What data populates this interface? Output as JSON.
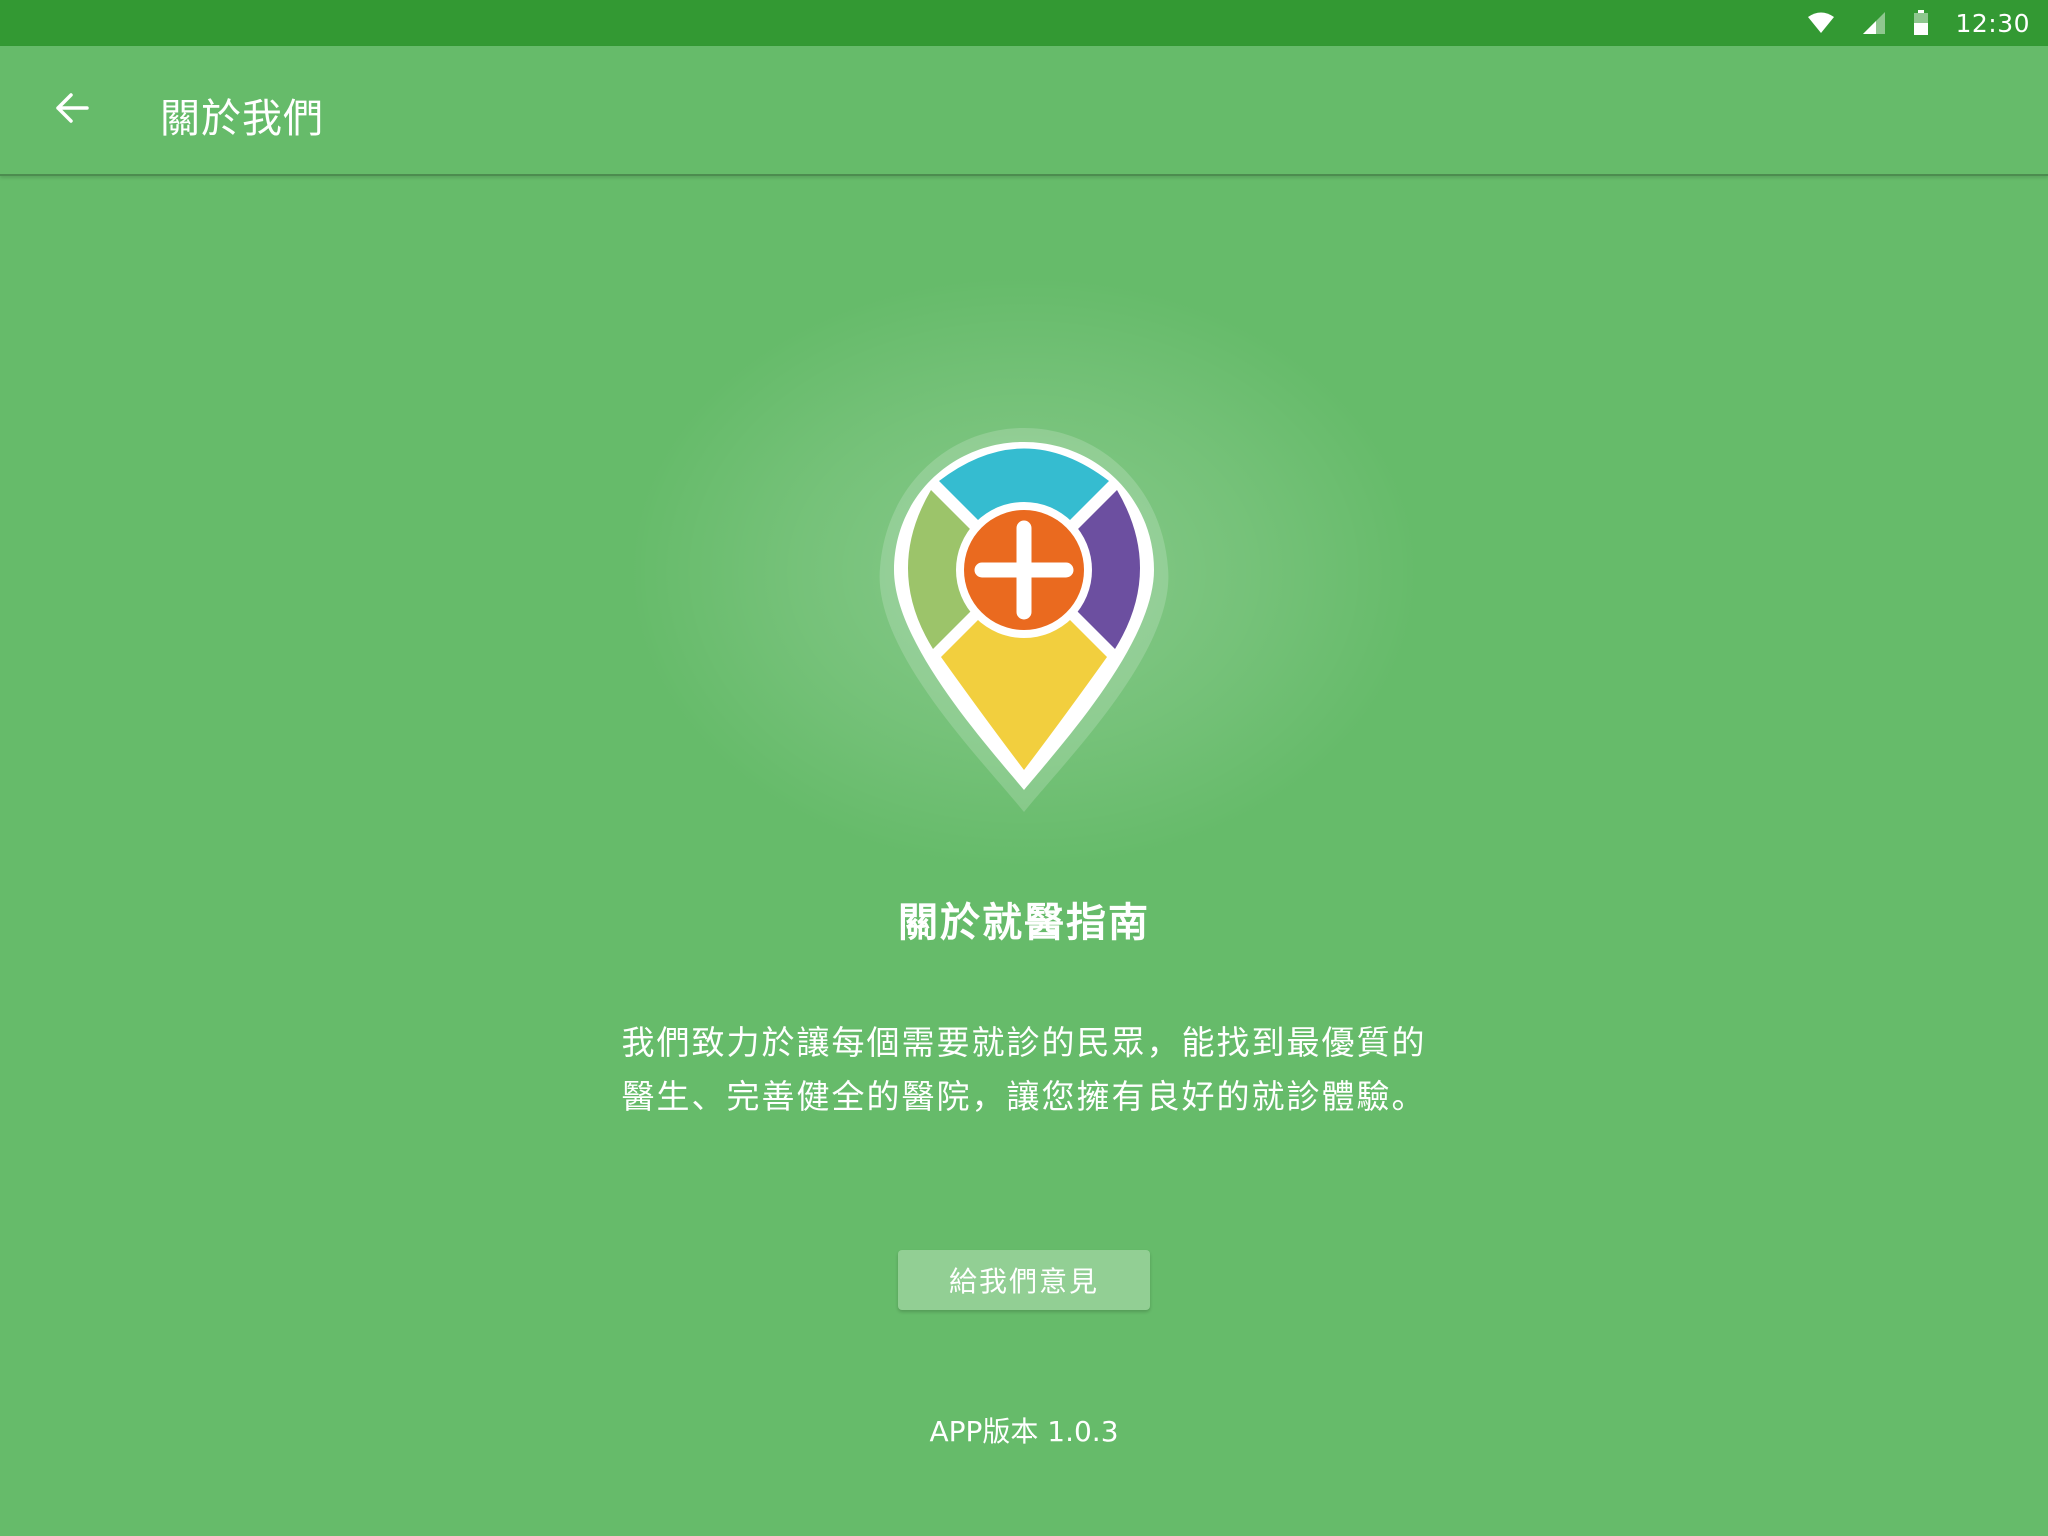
{
  "status_bar": {
    "time": "12:30",
    "icons": [
      "wifi-icon",
      "signal-icon",
      "battery-icon"
    ]
  },
  "toolbar": {
    "title": "關於我們",
    "back_icon": "arrow-left-icon"
  },
  "colors": {
    "status_bar": "#339933",
    "background": "#66bb6a",
    "logo_teal": "#35bcd0",
    "logo_purple": "#6c4fa0",
    "logo_green": "#9cc46a",
    "logo_yellow": "#f2cf3e",
    "logo_orange": "#ea6a1f",
    "button_bg": "#92cf94"
  },
  "main": {
    "about_title": "關於就醫指南",
    "description_lines": [
      "我們致力於讓每個需要就診的民眾，能找到最優質的",
      "醫生、完善健全的醫院，讓您擁有良好的就診體驗。"
    ],
    "feedback_button": "給我們意見",
    "version": "APP版本 1.0.3"
  }
}
